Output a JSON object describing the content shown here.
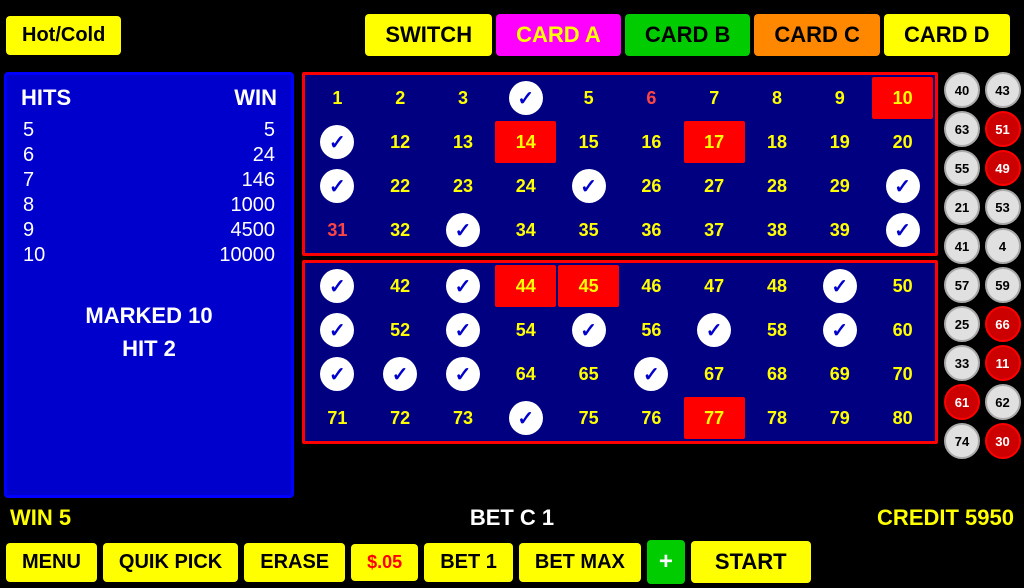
{
  "topBar": {
    "hotCold": "Hot/Cold",
    "tabs": [
      {
        "label": "SWITCH",
        "class": "tab-switch"
      },
      {
        "label": "CARD A",
        "class": "tab-a"
      },
      {
        "label": "CARD B",
        "class": "tab-b"
      },
      {
        "label": "CARD C",
        "class": "tab-c"
      },
      {
        "label": "CARD D",
        "class": "tab-d"
      }
    ]
  },
  "leftPanel": {
    "hitsLabel": "HITS",
    "winLabel": "WIN",
    "rows": [
      {
        "hits": "5",
        "win": "5"
      },
      {
        "hits": "6",
        "win": "24"
      },
      {
        "hits": "7",
        "win": "146"
      },
      {
        "hits": "8",
        "win": "1000"
      },
      {
        "hits": "9",
        "win": "4500"
      },
      {
        "hits": "10",
        "win": "10000"
      }
    ],
    "markedLine1": "MARKED 10",
    "markedLine2": "HIT 2"
  },
  "statusBar": {
    "win": "WIN 5",
    "bet": "BET C 1",
    "credit": "CREDIT 5950"
  },
  "actionBar": {
    "menu": "MENU",
    "quikPick": "QUIK PICK",
    "erase": "ERASE",
    "dollar": "$.05",
    "bet1": "BET 1",
    "betMax": "BET MAX",
    "plus": "+",
    "start": "START"
  },
  "rightBalls": [
    {
      "num": "40",
      "type": "white"
    },
    {
      "num": "43",
      "type": "white"
    },
    {
      "num": "63",
      "type": "white"
    },
    {
      "num": "51",
      "type": "red"
    },
    {
      "num": "55",
      "type": "white"
    },
    {
      "num": "49",
      "type": "red"
    },
    {
      "num": "21",
      "type": "white"
    },
    {
      "num": "53",
      "type": "white"
    },
    {
      "num": "41",
      "type": "white"
    },
    {
      "num": "4",
      "type": "white"
    },
    {
      "num": "57",
      "type": "white"
    },
    {
      "num": "59",
      "type": "white"
    },
    {
      "num": "25",
      "type": "white"
    },
    {
      "num": "66",
      "type": "red"
    },
    {
      "num": "33",
      "type": "white"
    },
    {
      "num": "11",
      "type": "red"
    },
    {
      "num": "61",
      "type": "red"
    },
    {
      "num": "62",
      "type": "white"
    },
    {
      "num": "74",
      "type": "white"
    },
    {
      "num": "30",
      "type": "red"
    }
  ]
}
